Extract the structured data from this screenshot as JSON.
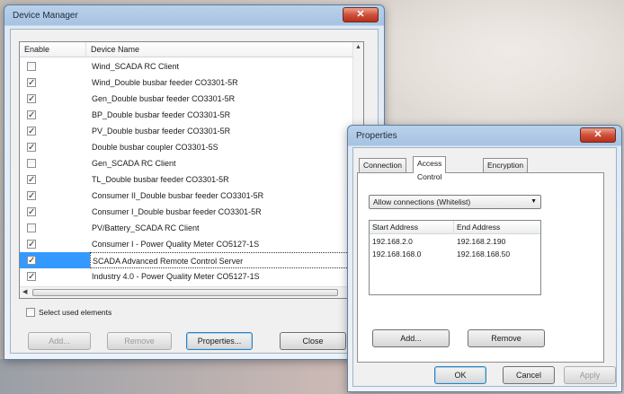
{
  "device_manager": {
    "title": "Device Manager",
    "close_glyph": "✕",
    "columns": {
      "enable": "Enable",
      "device_name": "Device Name"
    },
    "rows": [
      {
        "enabled": false,
        "name": "Wind_SCADA RC Client"
      },
      {
        "enabled": true,
        "name": "Wind_Double busbar feeder CO3301-5R"
      },
      {
        "enabled": true,
        "name": "Gen_Double busbar feeder CO3301-5R"
      },
      {
        "enabled": true,
        "name": "BP_Double busbar feeder CO3301-5R"
      },
      {
        "enabled": true,
        "name": "PV_Double busbar feeder CO3301-5R"
      },
      {
        "enabled": true,
        "name": "Double busbar coupler CO3301-5S"
      },
      {
        "enabled": false,
        "name": "Gen_SCADA RC Client"
      },
      {
        "enabled": true,
        "name": "TL_Double busbar feeder CO3301-5R"
      },
      {
        "enabled": true,
        "name": "Consumer II_Double busbar feeder CO3301-5R"
      },
      {
        "enabled": true,
        "name": "Consumer I_Double busbar feeder CO3301-5R"
      },
      {
        "enabled": false,
        "name": "PV/Battery_SCADA RC Client"
      },
      {
        "enabled": true,
        "name": "Consumer I - Power Quality Meter CO5127-1S"
      },
      {
        "enabled": true,
        "name": "SCADA Advanced Remote Control Server",
        "selected": true
      },
      {
        "enabled": true,
        "name": "Industry 4.0 - Power Quality Meter CO5127-1S"
      }
    ],
    "select_used_label": "Select used elements",
    "buttons": {
      "add": "Add...",
      "remove": "Remove",
      "properties": "Properties...",
      "close": "Close"
    }
  },
  "properties": {
    "title": "Properties",
    "close_glyph": "✕",
    "tabs": [
      "Connection",
      "Access Control",
      "Encryption"
    ],
    "active_tab": "Access Control",
    "mode_select": "Allow connections (Whitelist)",
    "table_headers": {
      "start": "Start Address",
      "end": "End Address"
    },
    "ranges": [
      {
        "start": "192.168.2.0",
        "end": "192.168.2.190"
      },
      {
        "start": "192.168.168.0",
        "end": "192.168.168.50"
      }
    ],
    "buttons": {
      "add": "Add...",
      "remove": "Remove",
      "ok": "OK",
      "cancel": "Cancel",
      "apply": "Apply"
    }
  }
}
